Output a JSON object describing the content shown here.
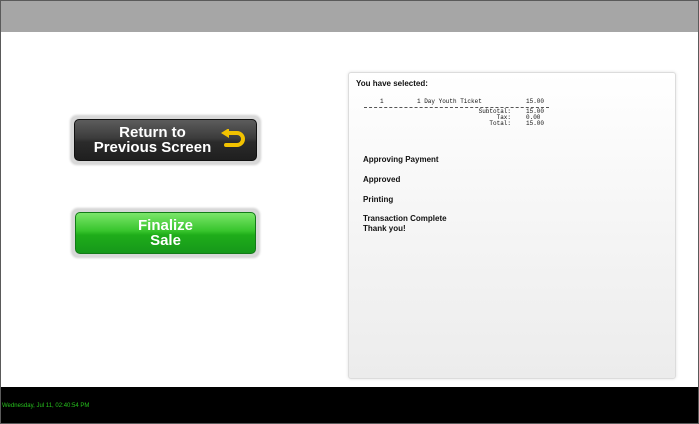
{
  "buttons": {
    "return_line1": "Return to",
    "return_line2": "Previous Screen",
    "finalize_line1": "Finalize",
    "finalize_line2": "Sale"
  },
  "receipt": {
    "title": "You have selected:",
    "item": {
      "qty": "1",
      "description": "1 Day Youth Ticket",
      "amount": "15.00"
    },
    "subtotal_label": "Subtotal:",
    "subtotal": "15.00",
    "tax_label": "Tax:",
    "tax": "0.00",
    "total_label": "Total:",
    "total": "15.00"
  },
  "status": {
    "approving": "Approving Payment",
    "approved": "Approved",
    "printing": "Printing",
    "complete": "Transaction Complete",
    "thanks": "Thank you!"
  },
  "footer": {
    "datetime": "Wednesday, Jul 11, 02:40:54 PM"
  },
  "colors": {
    "top_bar": "#a6a6a6",
    "footer_bg": "#000000",
    "clock_text": "#26c11d",
    "finalize_green": "#37c42c",
    "return_icon": "#f2c200"
  },
  "icons": {
    "return_icon": "return-arrow-icon"
  }
}
